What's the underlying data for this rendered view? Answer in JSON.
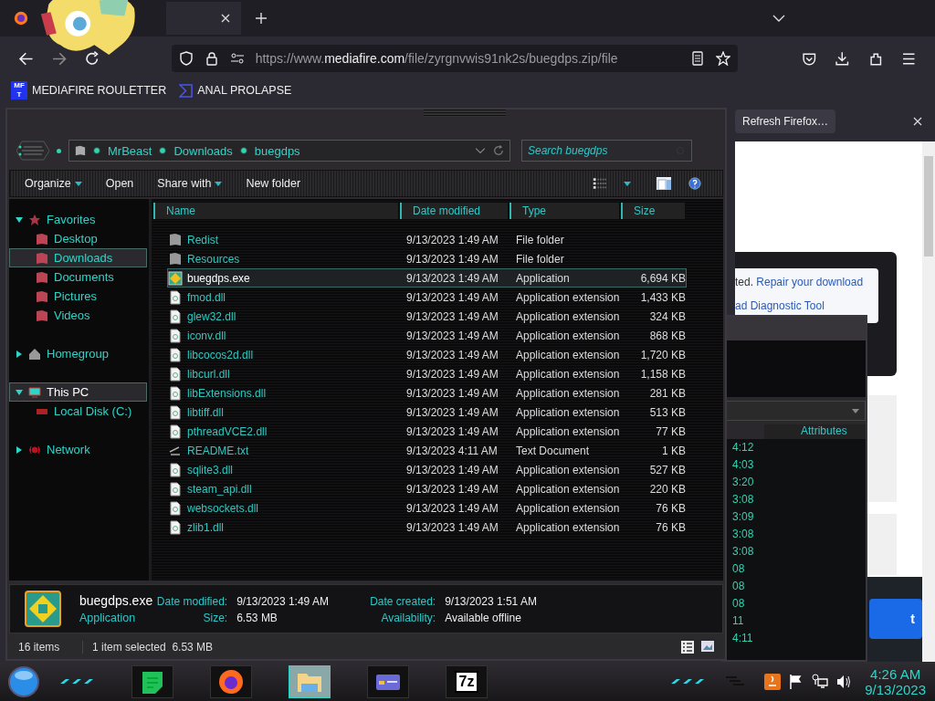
{
  "browser": {
    "address_bar": {
      "url_scheme": "https://www.",
      "url_host": "mediafire.com",
      "url_path": "/file/zyrgnvwis91nk2s/buegdps.zip/file"
    },
    "bookmarks": [
      {
        "label": "MEDIAFIRE ROULETTER",
        "kind": "badge",
        "badge_top": "MF",
        "badge_bottom": "T"
      },
      {
        "label": "ANAL PROLAPSE",
        "kind": "chevron"
      }
    ],
    "notification": {
      "button": "Refresh Firefox…"
    }
  },
  "web_page": {
    "message_tail": "ted.",
    "link": "Repair your download",
    "second_line": "ad Diagnostic Tool",
    "button": "t"
  },
  "explorer": {
    "breadcrumb": [
      "MrBeast",
      "Downloads",
      "buegdps"
    ],
    "search": {
      "placeholder": "Search buegdps"
    },
    "toolbar": [
      {
        "label": "Organize",
        "dropdown": true
      },
      {
        "label": "Open",
        "dropdown": false
      },
      {
        "label": "Share with",
        "dropdown": true
      },
      {
        "label": "New folder",
        "dropdown": false
      }
    ],
    "nav": [
      {
        "label": "Favorites",
        "kind": "star",
        "expanded": true,
        "selected": false,
        "children": [
          {
            "label": "Desktop",
            "kind": "folder",
            "selected": false
          },
          {
            "label": "Downloads",
            "kind": "folder",
            "selected": true
          },
          {
            "label": "Documents",
            "kind": "folder",
            "selected": false
          },
          {
            "label": "Pictures",
            "kind": "folder",
            "selected": false
          },
          {
            "label": "Videos",
            "kind": "folder",
            "selected": false
          }
        ]
      },
      {
        "label": "Homegroup",
        "kind": "home",
        "expanded": false,
        "selected": false
      },
      {
        "label": "This PC",
        "kind": "computer",
        "expanded": true,
        "selected": true,
        "children": [
          {
            "label": "Local Disk (C:)",
            "kind": "disk",
            "selected": false
          }
        ]
      },
      {
        "label": "Network",
        "kind": "network",
        "expanded": false,
        "selected": false
      }
    ],
    "columns": [
      "Name",
      "Date modified",
      "Type",
      "Size"
    ],
    "files": [
      {
        "name": "Redist",
        "date": "9/13/2023 1:49 AM",
        "type": "File folder",
        "kind": "folder",
        "selected": false
      },
      {
        "name": "Resources",
        "date": "9/13/2023 1:49 AM",
        "type": "File folder",
        "kind": "folder",
        "selected": false
      },
      {
        "name": "buegdps.exe",
        "date": "9/13/2023 1:49 AM",
        "type": "Application",
        "size": "6,694 KB",
        "kind": "exe",
        "selected": true
      },
      {
        "name": "fmod.dll",
        "date": "9/13/2023 1:49 AM",
        "type": "Application extension",
        "size": "1,433 KB",
        "kind": "dll",
        "selected": false
      },
      {
        "name": "glew32.dll",
        "date": "9/13/2023 1:49 AM",
        "type": "Application extension",
        "size": "324 KB",
        "kind": "dll",
        "selected": false
      },
      {
        "name": "iconv.dll",
        "date": "9/13/2023 1:49 AM",
        "type": "Application extension",
        "size": "868 KB",
        "kind": "dll",
        "selected": false
      },
      {
        "name": "libcocos2d.dll",
        "date": "9/13/2023 1:49 AM",
        "type": "Application extension",
        "size": "1,720 KB",
        "kind": "dll",
        "selected": false
      },
      {
        "name": "libcurl.dll",
        "date": "9/13/2023 1:49 AM",
        "type": "Application extension",
        "size": "1,158 KB",
        "kind": "dll",
        "selected": false
      },
      {
        "name": "libExtensions.dll",
        "date": "9/13/2023 1:49 AM",
        "type": "Application extension",
        "size": "281 KB",
        "kind": "dll",
        "selected": false
      },
      {
        "name": "libtiff.dll",
        "date": "9/13/2023 1:49 AM",
        "type": "Application extension",
        "size": "513 KB",
        "kind": "dll",
        "selected": false
      },
      {
        "name": "pthreadVCE2.dll",
        "date": "9/13/2023 1:49 AM",
        "type": "Application extension",
        "size": "77 KB",
        "kind": "dll",
        "selected": false
      },
      {
        "name": "README.txt",
        "date": "9/13/2023 4:11 AM",
        "type": "Text Document",
        "size": "1 KB",
        "kind": "txt",
        "selected": false
      },
      {
        "name": "sqlite3.dll",
        "date": "9/13/2023 1:49 AM",
        "type": "Application extension",
        "size": "527 KB",
        "kind": "dll",
        "selected": false
      },
      {
        "name": "steam_api.dll",
        "date": "9/13/2023 1:49 AM",
        "type": "Application extension",
        "size": "220 KB",
        "kind": "dll",
        "selected": false
      },
      {
        "name": "websockets.dll",
        "date": "9/13/2023 1:49 AM",
        "type": "Application extension",
        "size": "76 KB",
        "kind": "dll",
        "selected": false
      },
      {
        "name": "zlib1.dll",
        "date": "9/13/2023 1:49 AM",
        "type": "Application extension",
        "size": "76 KB",
        "kind": "dll",
        "selected": false
      }
    ],
    "details": {
      "name": "buegdps.exe",
      "type": "Application",
      "fields": [
        {
          "label": "Date modified:",
          "value": "9/13/2023 1:49 AM"
        },
        {
          "label": "Date created:",
          "value": "9/13/2023 1:51 AM"
        },
        {
          "label": "Size:",
          "value": "6.53 MB"
        },
        {
          "label": "Availability:",
          "value": "Available offline"
        }
      ]
    },
    "status": {
      "count": "16 items",
      "selection": "1 item selected  6.53 MB"
    }
  },
  "back_window": {
    "column": "Attributes",
    "rows": [
      "4:12",
      "4:03",
      "3:20",
      "3:08",
      "3:09",
      "3:08",
      "3:08",
      "08",
      "08",
      "08",
      "11",
      "4:11"
    ]
  },
  "taskbar": {
    "apps": [
      {
        "kind": "notes",
        "selected": false
      },
      {
        "kind": "firefox",
        "selected": false
      },
      {
        "kind": "explorer",
        "selected": true
      },
      {
        "kind": "card",
        "selected": false
      },
      {
        "kind": "archive",
        "selected": false,
        "glyph": "7z"
      }
    ],
    "clock": {
      "time": "4:26 AM",
      "date": "9/13/2023"
    }
  }
}
